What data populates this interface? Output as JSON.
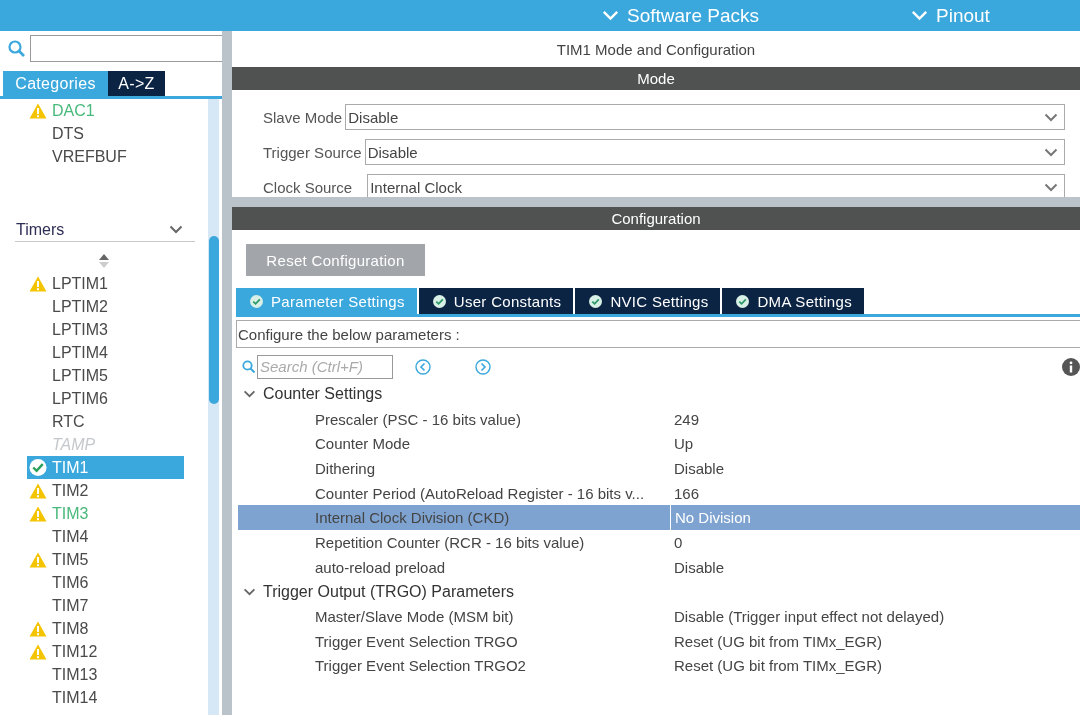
{
  "top_bar": {
    "menus": [
      {
        "label": "Software Packs"
      },
      {
        "label": "Pinout"
      }
    ]
  },
  "sidebar": {
    "tabs": [
      {
        "label": "Categories",
        "selected": true
      },
      {
        "label": "A->Z",
        "selected": false
      }
    ],
    "items": [
      {
        "label": "DAC1",
        "kind": "warning",
        "selected": false,
        "disabled": false,
        "color": "#48b97a"
      },
      {
        "label": "DTS",
        "kind": "plain",
        "selected": false,
        "disabled": false,
        "color": "#4a4a4a"
      },
      {
        "label": "VREFBUF",
        "kind": "plain",
        "selected": false,
        "disabled": false,
        "color": "#4a4a4a"
      }
    ],
    "group": {
      "label": "Timers",
      "expanded": true,
      "items": [
        {
          "label": "LPTIM1",
          "kind": "warning",
          "selected": false,
          "disabled": false,
          "color": "#4a4a4a"
        },
        {
          "label": "LPTIM2",
          "kind": "plain",
          "selected": false,
          "disabled": false,
          "color": "#4a4a4a"
        },
        {
          "label": "LPTIM3",
          "kind": "plain",
          "selected": false,
          "disabled": false,
          "color": "#4a4a4a"
        },
        {
          "label": "LPTIM4",
          "kind": "plain",
          "selected": false,
          "disabled": false,
          "color": "#4a4a4a"
        },
        {
          "label": "LPTIM5",
          "kind": "plain",
          "selected": false,
          "disabled": false,
          "color": "#4a4a4a"
        },
        {
          "label": "LPTIM6",
          "kind": "plain",
          "selected": false,
          "disabled": false,
          "color": "#4a4a4a"
        },
        {
          "label": "RTC",
          "kind": "plain",
          "selected": false,
          "disabled": false,
          "color": "#4a4a4a"
        },
        {
          "label": "TAMP",
          "kind": "plain",
          "selected": false,
          "disabled": true,
          "color": "#c4c8cc"
        },
        {
          "label": "TIM1",
          "kind": "ok",
          "selected": true,
          "disabled": false,
          "color": "#ffffff"
        },
        {
          "label": "TIM2",
          "kind": "warning",
          "selected": false,
          "disabled": false,
          "color": "#4a4a4a"
        },
        {
          "label": "TIM3",
          "kind": "warning",
          "selected": false,
          "disabled": false,
          "color": "#48b97a"
        },
        {
          "label": "TIM4",
          "kind": "plain",
          "selected": false,
          "disabled": false,
          "color": "#4a4a4a"
        },
        {
          "label": "TIM5",
          "kind": "warning",
          "selected": false,
          "disabled": false,
          "color": "#4a4a4a"
        },
        {
          "label": "TIM6",
          "kind": "plain",
          "selected": false,
          "disabled": false,
          "color": "#4a4a4a"
        },
        {
          "label": "TIM7",
          "kind": "plain",
          "selected": false,
          "disabled": false,
          "color": "#4a4a4a"
        },
        {
          "label": "TIM8",
          "kind": "warning",
          "selected": false,
          "disabled": false,
          "color": "#4a4a4a"
        },
        {
          "label": "TIM12",
          "kind": "warning",
          "selected": false,
          "disabled": false,
          "color": "#4a4a4a"
        },
        {
          "label": "TIM13",
          "kind": "plain",
          "selected": false,
          "disabled": false,
          "color": "#4a4a4a"
        },
        {
          "label": "TIM14",
          "kind": "plain",
          "selected": false,
          "disabled": false,
          "color": "#4a4a4a"
        }
      ]
    }
  },
  "main": {
    "title": "TIM1 Mode and Configuration",
    "mode_header": "Mode",
    "mode_fields": [
      {
        "label": "Slave Mode",
        "value": "Disable"
      },
      {
        "label": "Trigger Source",
        "value": "Disable"
      },
      {
        "label": "Clock Source",
        "value": "Internal Clock"
      }
    ],
    "config_header": "Configuration",
    "reset_button": "Reset Configuration",
    "tabs": [
      {
        "label": "Parameter Settings",
        "selected": true
      },
      {
        "label": "User Constants",
        "selected": false
      },
      {
        "label": "NVIC Settings",
        "selected": false
      },
      {
        "label": "DMA Settings",
        "selected": false
      }
    ],
    "hint": "Configure the below parameters :",
    "search": {
      "placeholder": "Search (Ctrl+F)"
    },
    "groups": [
      {
        "label": "Counter Settings",
        "expanded": true,
        "rows": [
          {
            "name": "Prescaler (PSC - 16 bits value)",
            "value": "249",
            "selected": false
          },
          {
            "name": "Counter Mode",
            "value": "Up",
            "selected": false
          },
          {
            "name": "Dithering",
            "value": "Disable",
            "selected": false
          },
          {
            "name": "Counter Period (AutoReload Register - 16 bits v...",
            "value": "166",
            "selected": false
          },
          {
            "name": "Internal Clock Division (CKD)",
            "value": "No Division",
            "selected": true
          },
          {
            "name": "Repetition Counter (RCR - 16 bits value)",
            "value": "0",
            "selected": false
          },
          {
            "name": "auto-reload preload",
            "value": "Disable",
            "selected": false
          }
        ]
      },
      {
        "label": "Trigger Output (TRGO) Parameters",
        "expanded": true,
        "rows": [
          {
            "name": "Master/Slave Mode (MSM bit)",
            "value": "Disable (Trigger input effect not delayed)",
            "selected": false
          },
          {
            "name": "Trigger Event Selection TRGO",
            "value": "Reset (UG bit from TIMx_EGR)",
            "selected": false
          },
          {
            "name": "Trigger Event Selection TRGO2",
            "value": "Reset (UG bit from TIMx_EGR)",
            "selected": false
          }
        ]
      }
    ]
  }
}
